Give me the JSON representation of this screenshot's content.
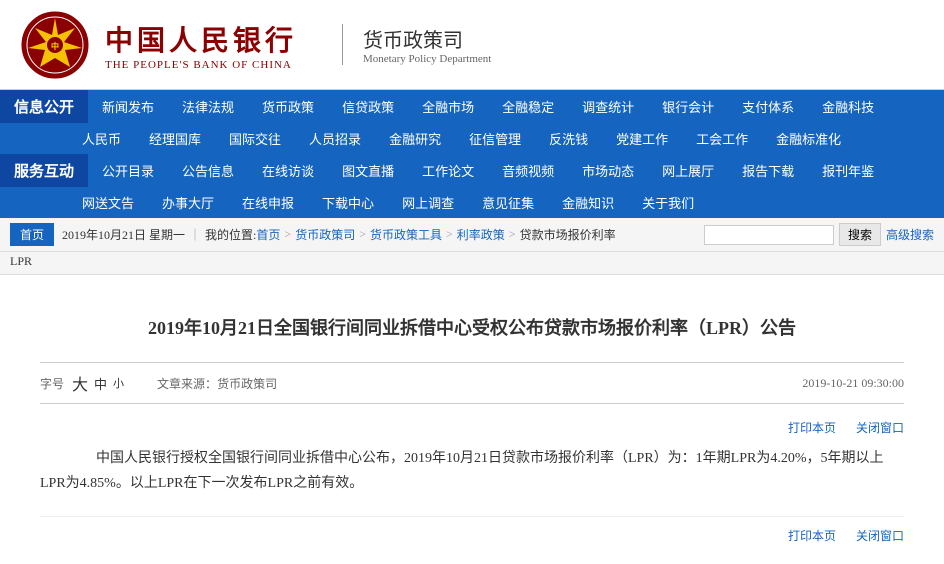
{
  "header": {
    "logo_cn": "中国人民银行",
    "logo_en": "THE PEOPLE'S BANK OF CHINA",
    "dept_cn": "货币政策司",
    "dept_en": "Monetary Policy Department"
  },
  "nav": {
    "section1_label": "信息公开",
    "section2_label": "服务互动",
    "row1": [
      "新闻发布",
      "法律法规",
      "货币政策",
      "信贷政策",
      "全融市场",
      "全融稳定",
      "调查统计",
      "银行会计",
      "支付体系",
      "金融科技"
    ],
    "row2": [
      "人民币",
      "经理国库",
      "国际交往",
      "人员招录",
      "金融研究",
      "征信管理",
      "反洗钱",
      "党建工作",
      "工会工作",
      "金融标准化"
    ],
    "row3": [
      "公开目录",
      "公告信息",
      "在线访谈",
      "图文直播",
      "工作论文",
      "音频视频",
      "市场动态",
      "网上展厅",
      "报告下载",
      "报刊年鉴"
    ],
    "row4": [
      "网送文告",
      "办事大厅",
      "在线申报",
      "下载中心",
      "网上调查",
      "意见征集",
      "金融知识",
      "关于我们"
    ]
  },
  "breadcrumb": {
    "home": "首页",
    "items": [
      {
        "label": "2019年10月21日 星期一",
        "link": false
      },
      {
        "label": "我的位置:首页",
        "link": true
      },
      {
        "label": "货币政策司",
        "link": true
      },
      {
        "label": "货币政策工具",
        "link": true
      },
      {
        "label": "利率政策",
        "link": true
      },
      {
        "label": "贷款市场报价利率",
        "link": false
      }
    ],
    "sublabel": "LPR",
    "search_placeholder": "",
    "search_btn": "搜索",
    "advanced_search": "高级搜索"
  },
  "article": {
    "title": "2019年10月21日全国银行间同业拆借中心受权公布贷款市场报价利率（LPR）公告",
    "font_label": "字号",
    "font_large": "大",
    "font_medium": "中",
    "font_small": "小",
    "source_label": "文章来源：",
    "source": "货币政策司",
    "date": "2019-10-21  09:30:00",
    "print": "打印本页",
    "close": "关闭窗口",
    "body": "　　中国人民银行授权全国银行间同业拆借中心公布，2019年10月21日贷款市场报价利率（LPR）为：1年期LPR为4.20%，5年期以上LPR为4.85%。以上LPR在下一次发布LPR之前有效。",
    "print2": "打印本页",
    "close2": "关闭窗口"
  }
}
